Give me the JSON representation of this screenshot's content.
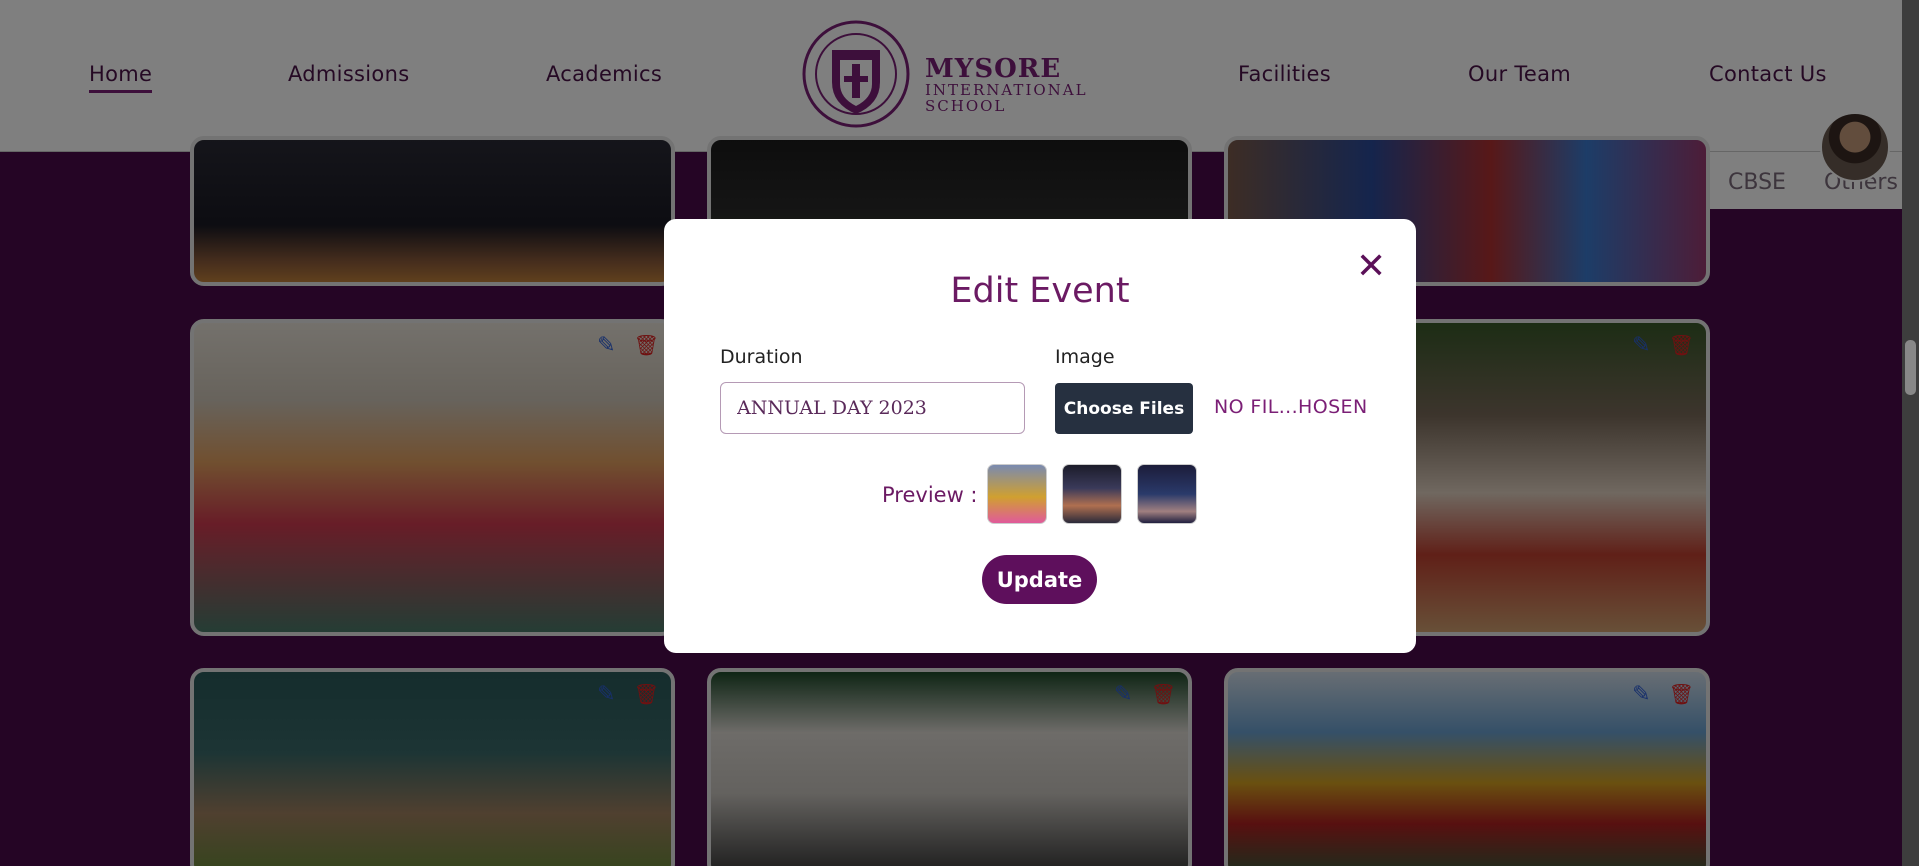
{
  "nav": {
    "items": [
      "Home",
      "Admissions",
      "Academics",
      "Facilities",
      "Our Team",
      "Contact Us"
    ],
    "active": "Home"
  },
  "brand": {
    "line1": "MYSORE",
    "line2": "INTERNATIONAL",
    "line3": "SCHOOL"
  },
  "subtabs": [
    "CBSE",
    "Others"
  ],
  "gallery": {
    "card_icons": [
      "edit-icon",
      "trash-icon"
    ]
  },
  "modal": {
    "title": "Edit Event",
    "duration_label": "Duration",
    "duration_value": "ANNUAL DAY 2023",
    "image_label": "Image",
    "choose_files_label": "Choose Files",
    "file_status": "NO FIL...HOSEN",
    "preview_label": "Preview :",
    "update_label": "Update"
  },
  "colors": {
    "brand_purple": "#7b1f76",
    "background_purple": "#4a0a4a",
    "choose_button": "#263040",
    "update_button": "#5e0f5c"
  }
}
